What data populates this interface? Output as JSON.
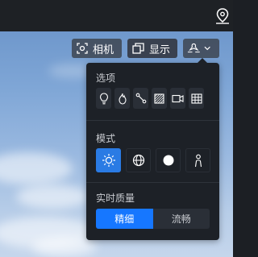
{
  "toolbar": {
    "camera_label": "相机",
    "display_label": "显示",
    "camera_icon": "camera-frame-icon",
    "display_icon": "layers-icon",
    "drone_icon": "drone-icon",
    "dropdown_icon": "chevron-down-icon"
  },
  "topbar": {
    "pin_icon": "map-pin-icon"
  },
  "panel": {
    "options_title": "选项",
    "option_icons": [
      "bulb-icon",
      "fire-icon",
      "route-icon",
      "hatched-square-icon",
      "video-icon",
      "grid-icon"
    ],
    "mode_title": "模式",
    "mode_icons": [
      "sun-icon",
      "globe-icon",
      "circle-icon",
      "person-icon"
    ],
    "mode_selected": 0,
    "quality_title": "实时质量",
    "quality_options": [
      "精细",
      "流畅"
    ],
    "quality_selected": 0
  },
  "colors": {
    "accent": "#1677ff",
    "panel_bg": "#1d2127",
    "button_bg": "#2a2f37"
  }
}
